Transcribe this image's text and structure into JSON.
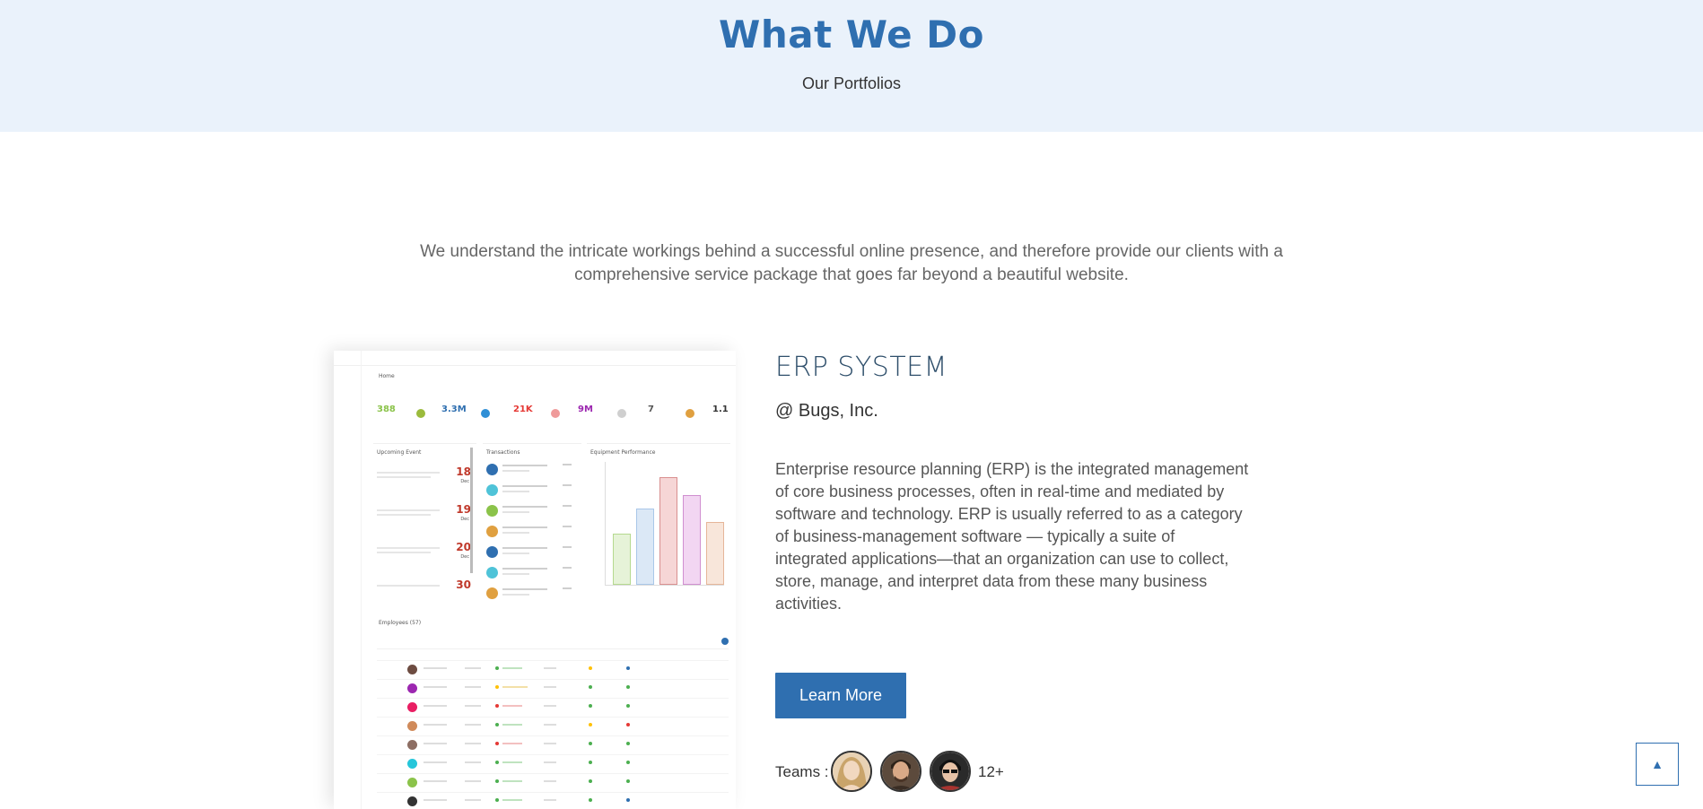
{
  "hero": {
    "title": "What We Do",
    "subtitle": "Our Portfolios"
  },
  "intro": {
    "text": "We understand the intricate workings behind a successful online presence, and therefore provide our clients with a comprehensive service package that goes far beyond a beautiful website."
  },
  "portfolio": {
    "title": "ERP SYSTEM",
    "company": "@ Bugs, Inc.",
    "description": "Enterprise resource planning (ERP) is the integrated management of core business processes, often in real-time and mediated by software and technology. ERP is usually referred to as a category of business-management software — typically a suite of integrated applications—that an organization can use to collect, store, manage, and interpret data from these many business activities.",
    "button_label": "Learn More",
    "teams_label": "Teams :",
    "teams_more": "12+"
  },
  "screenshot": {
    "page_label": "Home",
    "stats": [
      {
        "value": "388",
        "color": "#8bc34a"
      },
      {
        "value": "3.3M",
        "color": "#2f6fb0"
      },
      {
        "value": "21K",
        "color": "#e53935"
      },
      {
        "value": "9M",
        "color": "#9c27b0"
      },
      {
        "value": "7",
        "color": "#555555"
      },
      {
        "value": "1.1",
        "color": "#333333"
      }
    ],
    "panel_titles": [
      "Upcoming Event",
      "Transactions",
      "Equipment Performance"
    ],
    "events": [
      {
        "date": "18",
        "month": "Dec"
      },
      {
        "date": "19",
        "month": "Dec"
      },
      {
        "date": "20",
        "month": "Dec"
      },
      {
        "date": "30",
        "month": ""
      }
    ],
    "table_title": "Employees (57)"
  },
  "back_to_top": {
    "label": "▲"
  },
  "colors": {
    "primary": "#2f6fb0",
    "hero_bg": "#eaf2fb"
  }
}
